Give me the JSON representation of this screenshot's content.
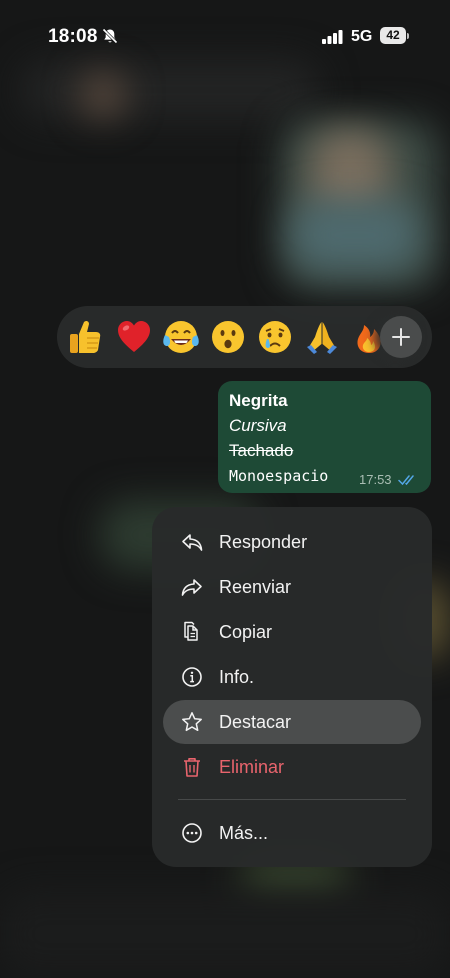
{
  "status_bar": {
    "time": "18:08",
    "network": "5G",
    "battery": "42"
  },
  "reactions": {
    "items": [
      "thumbs-up",
      "red-heart",
      "tears-of-joy",
      "surprised-face",
      "crying-face",
      "folded-hands",
      "fire"
    ]
  },
  "message": {
    "bold": "Negrita",
    "italic": "Cursiva",
    "strikethrough": "Tachado",
    "monospace": "Monoespacio",
    "time": "17:53",
    "status": "read"
  },
  "menu": {
    "reply": "Responder",
    "forward": "Reenviar",
    "copy": "Copiar",
    "info": "Info.",
    "star": "Destacar",
    "delete": "Eliminar",
    "more": "Más..."
  },
  "colors": {
    "bubble": "#1e4a36",
    "danger": "#e9646d",
    "read_ticks": "#53a6e6"
  }
}
